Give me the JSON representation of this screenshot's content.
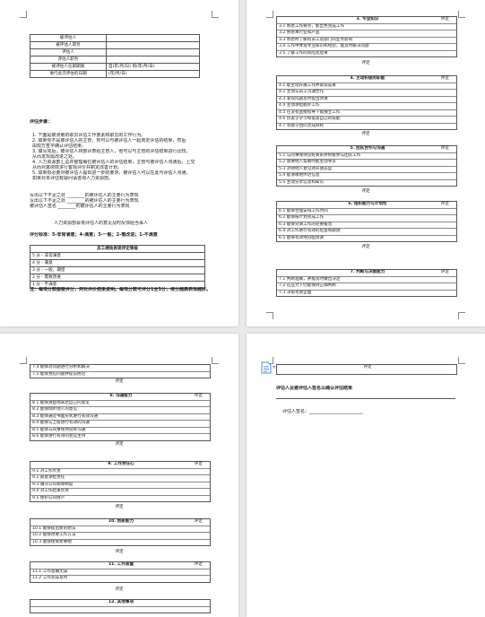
{
  "page1": {
    "info_rows": [
      {
        "label": "被评估人",
        "value": ""
      },
      {
        "label": "被评估人职务",
        "value": ""
      },
      {
        "label": "评估人",
        "value": ""
      },
      {
        "label": "评估人职务",
        "value": ""
      },
      {
        "label": "被评估人任职期限",
        "value": "自(年/月/日)    到(年/月/日)"
      },
      {
        "label": "进行此次评估的日期",
        "value": "(年/月/日)"
      }
    ],
    "steps_title": "评估步骤：",
    "steps": [
      "1.   下面是被测量的职员评估工作要素和职员的工作行为。",
      "2.   如果你不是被评估人的主管，你可以与被评估人一起商定评估的结果，然后",
      "      由双方签字确认评估结果。",
      "3.   填写完后，被评估人将部评表给主管人，他可以与主管的评估结果进行比较，",
      "      从而发现需改进之处。",
      "4.   人力资源部汇总并整理每位被评估人的评估结果，主管与被评估人沟通后，上交",
      "      从而对其绩效进行客观评价并制定改善计划。",
      "5.   如果有必要对被评估人提出进一步的要求，被评估人可以在此与评估人沟通。",
      "      如果对本评估有疑问请咨询人力资源部。"
    ],
    "sign_lines": [
      "写出以下不足之处 ________的被评估人的主要行为表现",
      "写出以下不足之处 ________的被评估人的主要行为表现",
      "被评估人签名 ________的被评估人的主要行为表现"
    ],
    "center_note": "人力资源部会将评估人的意见及时反馈给当事人",
    "scoring_title": "评分标准：5-非常满意；4-满意；3-一般；2-需改进；1-不满意",
    "scale_header": "员工绩效表现评定等级",
    "scale": [
      "5 分 - 非常满意",
      "4 分 - 满意",
      "3 分 - 一般，期望",
      "2 分 - 需要改进",
      "1 分 - 不满意"
    ],
    "footer_note": "注：每项分数都要评分，并对评价结果说明。每项分数可评分1至5分，得分越高表现越好。"
  },
  "page2": {
    "sections": [
      {
        "title": "3. 专业知识",
        "comment": "评定",
        "items": [
          "3.1 熟悉工作要点，能出色完成工作",
          "3.2 熟悉本行业和产品",
          "3.3 熟悉所了解的员工及部门的业务影响",
          "3.4 工作中体现专业知识和经验，能及时解决问题",
          "3.5 了解工作的风险及后果"
        ],
        "score": "评定"
      },
      {
        "title": "4. 主动积极的职能",
        "comment": "评定",
        "items": [
          "4.1 能主动开展工作并取得成果",
          "4.2 主动与员工沟通合作",
          "4.3 发现问题及时提出改进",
          "4.4 主动承担额外工作",
          "4.5 在没有直接指导下能独立工作",
          "4.6 热衷于学习和提高自己的技能",
          "4.7 有助于团队达成目标"
        ],
        "score": "评定"
      },
      {
        "title": "5. 团队合作与沟通",
        "comment": "评定",
        "items": [
          "5.1 与同事保持良好关系并积极参与团队工作",
          "5.2 需要他人帮助时能主动寻求",
          "5.3 对待他人意见持开放态度",
          "5.4 能清晰地传达信息",
          "5.5 主动分享信息和知识"
        ],
        "score": "评定"
      },
      {
        "title": "6. 组织能力与计划性",
        "comment": "评定",
        "items": [
          "6.1 能够合理安排工作时间",
          "6.2 能够按计划完成工作",
          "6.3 能够分清工作的轻重缓急",
          "6.4 对工作进行有效的检查和跟进",
          "6.5 能够有效地分配资源"
        ],
        "score": "评定"
      },
      {
        "title": "7. 判断与决策能力",
        "comment": "评定",
        "items": [
          "7.1 判断准确，并能及时做出决定",
          "7.2 在压力下仍能保持正确判断",
          "7.3 决策考虑全面"
        ],
        "score": "评定"
      }
    ]
  },
  "page3": {
    "top_items": [
      "7.4 能够对问题进行分析和解决",
      "7.5 能够预见问题并提前防范"
    ],
    "top_score": "评定",
    "sections": [
      {
        "title": "8. 沟通能力",
        "comment": "评定",
        "items": [
          "8.1 能够清楚地表达自己的意见",
          "8.2 能够倾听他人的意见",
          "8.3 能够通过书面形式进行有效沟通",
          "8.4 能够与上级进行有效的沟通",
          "8.5 能够与同事保持良好沟通",
          "8.6 能够进行有效的会议主持"
        ],
        "score": "评定"
      },
      {
        "title": "9. 工作责任心",
        "comment": "评定",
        "items": [
          "9.1 对工作负责",
          "9.2 愿意承担责任",
          "9.3 遵守公司规章制度",
          "9.4 对工作结果负责",
          "9.5 保护公司财产"
        ],
        "score": "评定"
      },
      {
        "title": "10. 创新能力",
        "comment": "评定",
        "items": [
          "10.1 能够提出新的想法",
          "10.2 能够改进工作方法",
          "10.3 能够接受新事物"
        ],
        "score": "评定"
      },
      {
        "title": "11. 工作质量",
        "comment": "评定",
        "items": [
          "11.1 工作准确无误",
          "11.2 工作完成及时"
        ],
        "score": "评定"
      },
      {
        "title": "12. 其他事项",
        "comment": "",
        "items": [],
        "score": ""
      }
    ]
  },
  "page4": {
    "comment_label": "评定",
    "title": "评估人及被评估人签名以确认评估结果",
    "sign_label": "评估人签名：",
    "sign_line": "________________________"
  },
  "colors": {
    "page": "#ffffff",
    "background": "#e9e9e9",
    "border": "#555555",
    "comment_icon": "#5b8ed6"
  }
}
